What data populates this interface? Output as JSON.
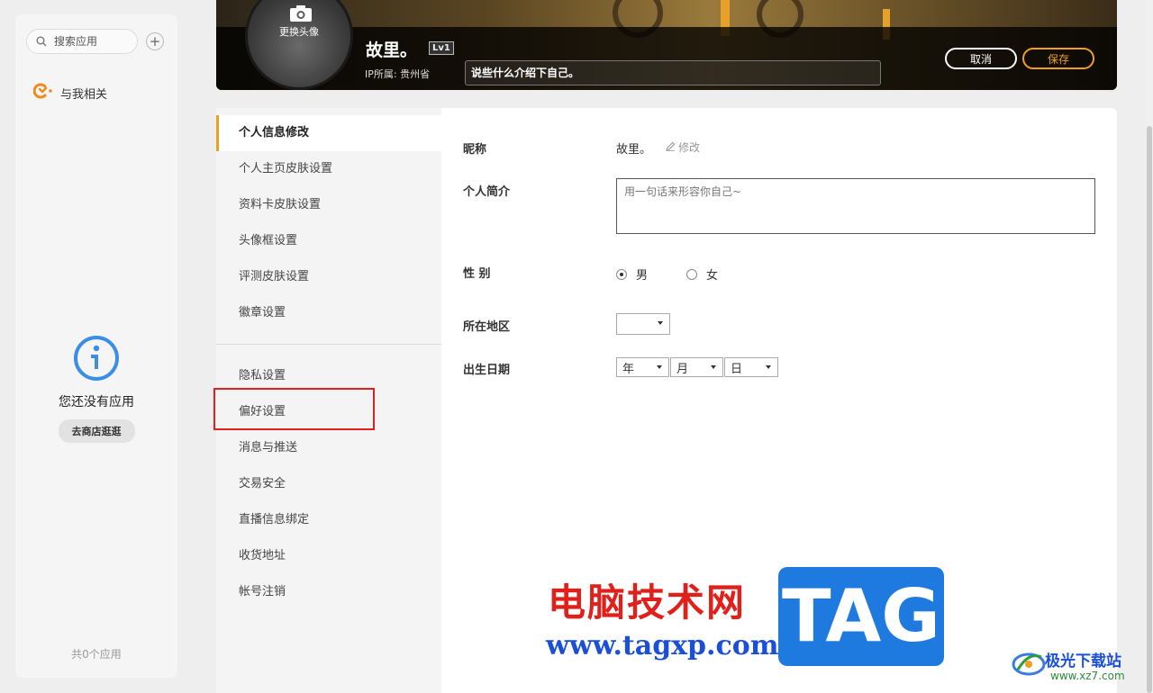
{
  "apps_panel": {
    "search_placeholder": "搜索应用",
    "add_symbol": "+",
    "related_label": "与我相关",
    "empty_title": "您还没有应用",
    "go_shop_label": "去商店逛逛",
    "app_count": "共0个应用"
  },
  "profile": {
    "change_avatar_label": "更换头像",
    "nickname": "故里。",
    "level": "Lv1",
    "ip_location": "IP所属: 贵州省",
    "intro_placeholder": "说些什么介绍下自己。",
    "cancel_label": "取消",
    "save_label": "保存"
  },
  "nav": {
    "group1": [
      "个人信息修改",
      "个人主页皮肤设置",
      "资料卡皮肤设置",
      "头像框设置",
      "评测皮肤设置",
      "徽章设置"
    ],
    "group2": [
      "隐私设置",
      "偏好设置",
      "消息与推送",
      "交易安全",
      "直播信息绑定",
      "收货地址",
      "帐号注销"
    ],
    "active": "个人信息修改",
    "highlighted": "偏好设置"
  },
  "form": {
    "nickname_label": "昵称",
    "nickname_value": "故里。",
    "edit_label": "修改",
    "intro_label": "个人简介",
    "intro_placeholder": "用一句话来形容你自己~",
    "gender_label": "性 别",
    "gender_male": "男",
    "gender_female": "女",
    "gender_selected": "男",
    "region_label": "所在地区",
    "region_value": "",
    "birth_label": "出生日期",
    "birth_year": "年",
    "birth_month": "月",
    "birth_day": "日"
  },
  "watermark": {
    "cn_text": "电脑技术网",
    "url": "www.tagxp.com",
    "tag": "TAG",
    "site_name": "极光下载站",
    "site_url": "www.xz7.com"
  },
  "colors": {
    "accent": "#f0a020",
    "highlight_border": "#e02020",
    "app_accent": "#f08a1c",
    "info_icon": "#3a8ee6"
  }
}
